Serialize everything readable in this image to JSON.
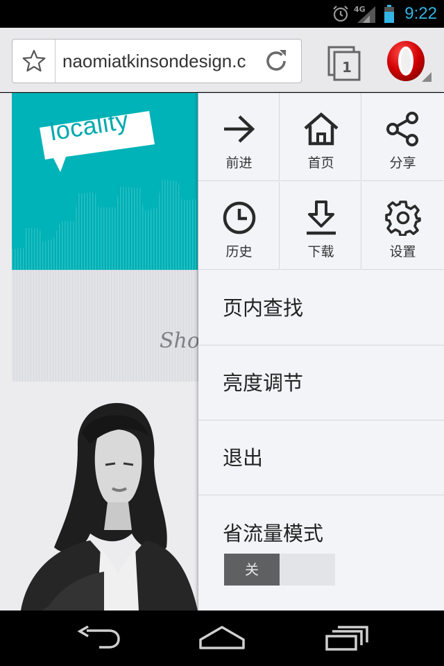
{
  "status_bar": {
    "time": "9:22",
    "network": "4G",
    "icons": [
      "alarm-icon",
      "signal-icon",
      "battery-icon"
    ],
    "time_color": "#33b5e5"
  },
  "toolbar": {
    "url": "naomiatkinsondesign.c",
    "tab_count": "1",
    "icons": [
      "star-icon",
      "reload-icon",
      "tabs-icon",
      "opera-logo-icon"
    ]
  },
  "webpage": {
    "logo_text": "locality",
    "caption": "Sho",
    "accent_color": "#00b3b8"
  },
  "menu": {
    "grid": [
      {
        "label": "前进",
        "icon": "forward-arrow-icon"
      },
      {
        "label": "首页",
        "icon": "home-icon"
      },
      {
        "label": "分享",
        "icon": "share-icon"
      },
      {
        "label": "历史",
        "icon": "history-clock-icon"
      },
      {
        "label": "下载",
        "icon": "download-icon"
      },
      {
        "label": "设置",
        "icon": "settings-gear-icon"
      }
    ],
    "find_in_page": "页内查找",
    "brightness": "亮度调节",
    "exit": "退出",
    "data_saver": {
      "label": "省流量模式",
      "toggle_state": "关"
    }
  },
  "nav_bar": {
    "icons": [
      "back-icon",
      "home-nav-icon",
      "recent-apps-icon"
    ]
  }
}
